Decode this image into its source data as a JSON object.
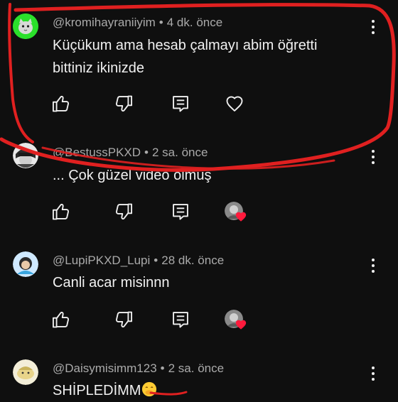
{
  "comments": [
    {
      "handle": "@kromihayraniiyim",
      "time": "4 dk. önce",
      "text_lines": [
        "Küçükum ama hesab çalmayı abim öğretti",
        "bittiniz ikinizde"
      ],
      "avatar": "green-cat-avatar"
    },
    {
      "handle": "@BestussPKXD",
      "time": "2 sa. önce",
      "text_lines": [
        "... Çok güzel video olmuş"
      ],
      "avatar": "dark-character-avatar",
      "creator_hearted": true
    },
    {
      "handle": "@LupiPKXD_Lupi",
      "time": "28 dk. önce",
      "text_lines": [
        "Canli acar misinnn"
      ],
      "avatar": "blue-character-avatar",
      "creator_hearted": true
    },
    {
      "handle": "@Daisymisimm123",
      "time": "2 sa. önce",
      "text_lines": [
        "SHİPLEDİMM"
      ],
      "avatar": "yellow-character-avatar",
      "text_emoji": "face-with-hand-over-mouth"
    }
  ],
  "colors": {
    "background": "#0f0f0f",
    "text": "#f1f1f1",
    "meta": "#aaaaaa",
    "annotation_red": "#e02020",
    "heart_red": "#ff1a3c"
  },
  "separator": "•"
}
